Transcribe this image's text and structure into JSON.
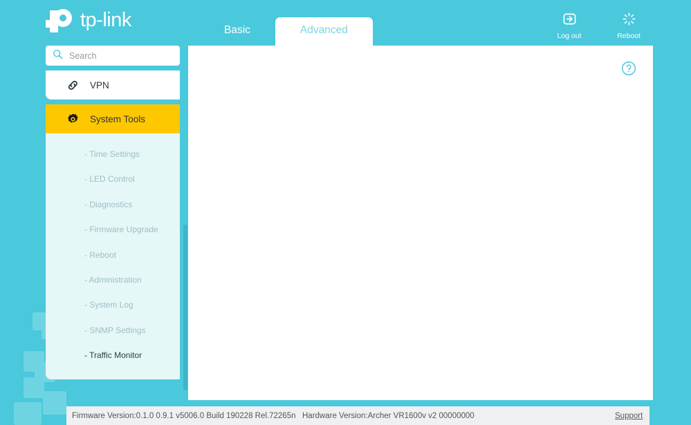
{
  "brand": {
    "name": "tp-link",
    "logo_icon": "tplink-logo-icon"
  },
  "header": {
    "tabs": [
      {
        "label": "Basic",
        "active": false
      },
      {
        "label": "Advanced",
        "active": true
      }
    ],
    "actions": [
      {
        "label": "Log out",
        "icon": "logout-icon"
      },
      {
        "label": "Reboot",
        "icon": "reboot-icon"
      }
    ]
  },
  "sidebar": {
    "search": {
      "placeholder": "Search",
      "value": "",
      "icon": "search-icon"
    },
    "items": [
      {
        "label": "VPN",
        "icon": "vpn-link-icon",
        "active": false
      },
      {
        "label": "System Tools",
        "icon": "gear-icon",
        "active": true
      }
    ],
    "submenu": [
      {
        "label": "- Time Settings",
        "selected": false
      },
      {
        "label": "- LED Control",
        "selected": false
      },
      {
        "label": "- Diagnostics",
        "selected": false
      },
      {
        "label": "- Firmware Upgrade",
        "selected": false
      },
      {
        "label": "- Reboot",
        "selected": false
      },
      {
        "label": "- Administration",
        "selected": false
      },
      {
        "label": "- System Log",
        "selected": false
      },
      {
        "label": "- SNMP Settings",
        "selected": false
      },
      {
        "label": "- Traffic Monitor",
        "selected": true
      }
    ]
  },
  "content": {
    "help_icon": "help-question-icon"
  },
  "footer": {
    "firmware_version": "Firmware Version:0.1.0 0.9.1 v5006.0 Build 190228 Rel.72265n",
    "hardware_version": "Hardware Version:Archer VR1600v v2 00000000",
    "support_label": "Support"
  },
  "colors": {
    "teal_background": "#4ac8dc",
    "deco_block": "#6fd4e2",
    "accent_yellow": "#fdc800",
    "submenu_background": "#e6f7f7",
    "content_background": "#ffffff",
    "footer_background": "#eef0f1",
    "scrollbar_thumb": "#3fb5c9"
  }
}
